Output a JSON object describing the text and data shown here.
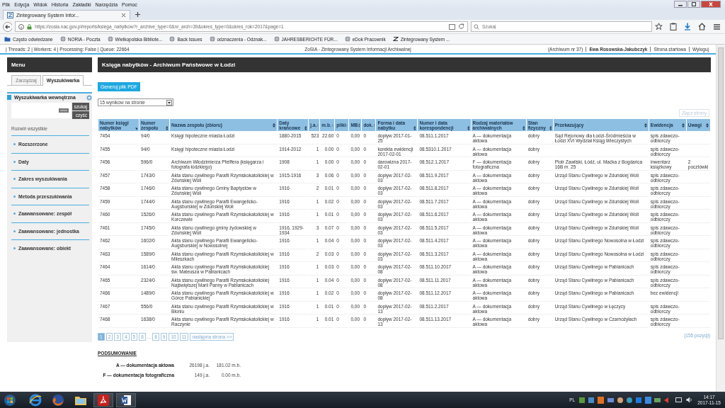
{
  "browser": {
    "menu": [
      "Plik",
      "Edycja",
      "Widok",
      "Historia",
      "Zakładki",
      "Narzędzia",
      "Pomoc"
    ],
    "tab": {
      "title": "Zintegrowany System Infor..."
    },
    "url": "https://zosia.nac.gov.pl/reports/ksiega_nabytkow?r_archive_type=0&nr_arch=39&okres_type=0&okres_rok=2017&page=1",
    "search": {
      "placeholder": "Szukaj"
    },
    "bookmarks": [
      {
        "label": "Często odwiedzane",
        "kind": "folder"
      },
      {
        "label": "NORIA - Poczta",
        "kind": "site"
      },
      {
        "label": "Wielkopolska Bibliote...",
        "kind": "site"
      },
      {
        "label": "Back Issues",
        "kind": "site"
      },
      {
        "label": "odznaczenia - Odznak...",
        "kind": "site"
      },
      {
        "label": "JAHRESBERICHTE FÜR...",
        "kind": "site"
      },
      {
        "label": "eDok Pracownik",
        "kind": "site"
      },
      {
        "label": "Zintegrowany System ...",
        "kind": "app"
      }
    ]
  },
  "status": {
    "info": "| Threads: 2 | Workers: 4 | Processing: False | Queue: 22664",
    "center": "ZoSIA - Zintegrowany System Informacji Archiwalnej",
    "archive": "(Archiwum nr 37)",
    "user": "Ewa Rosowska-Jakubczyk",
    "links": [
      "Strona startowa",
      "Wyloguj"
    ]
  },
  "sidebar": {
    "title": "Menu",
    "tabs": [
      {
        "label": "Zarządzaj",
        "selected": false
      },
      {
        "label": "Wyszukiwarka",
        "selected": true
      }
    ],
    "search": {
      "title": "Wyszukiwarka wewnętrzna",
      "buttons": [
        "szukaj",
        "czyść"
      ]
    },
    "expand_all": "Rozwiń wszystkie",
    "sections": [
      "Rozszerzone",
      "Daty",
      "Zakres wyszukiwania",
      "Metoda przeszukiwania",
      "Zaawansowane: zespół",
      "Zaawansowane: jednostka",
      "Zaawansowane: obiekt"
    ]
  },
  "main": {
    "title": "Księga nabytków - Archiwum Państwowe w Łodzi",
    "pdf_button": "Generuj plik PDF",
    "per_page": "15 wyników na stronie",
    "merge_button": {
      "label": "Złącz strony",
      "disabled": true
    },
    "table": {
      "columns": [
        {
          "label": "Numer księgi nabytków",
          "sorted": true
        },
        {
          "label": "Numer zespołu",
          "sorted": false
        },
        {
          "label": "Nazwa zespołu (zbioru)",
          "sorted": false
        },
        {
          "label": "Daty krańcowe",
          "sorted": false
        },
        {
          "label": "j.a.",
          "sorted": false
        },
        {
          "label": "m.b.",
          "sorted": false
        },
        {
          "label": "pliki",
          "sorted": false
        },
        {
          "label": "MB",
          "sorted": false
        },
        {
          "label": "dok.",
          "sorted": false
        },
        {
          "label": "Forma i data nabytku",
          "sorted": false
        },
        {
          "label": "Numer i data korespondencji",
          "sorted": false
        },
        {
          "label": "Rodzaj materiałów archiwalnych",
          "sorted": false
        },
        {
          "label": "Stan fizyczny",
          "sorted": false
        },
        {
          "label": "Przekazujący",
          "sorted": false
        },
        {
          "label": "Ewidencja",
          "sorted": false
        },
        {
          "label": "Uwagi",
          "sorted": false
        }
      ],
      "rows": [
        [
          "7454",
          "94/0",
          "Księgi hipoteczne miasta Łodzi",
          "1880-2015",
          "523",
          "22.60",
          "0",
          "0,00",
          "0",
          "dopływ 2017-01-25",
          "08.511.1.2017",
          "A — dokumentacja aktowa",
          "dobry",
          "Sąd Rejonowy dla Łodzi-Śródmieścia w Łodzi XVI Wydział Ksiąg Wieczystych",
          "spis zdawczo-odbiorczy",
          null
        ],
        [
          "7455",
          "94/0",
          "Księgi hipoteczne miasta Łodzi",
          "1914-2012",
          "1",
          "0.00",
          "0",
          "0,00",
          "0",
          "korekta ewidencji 2017-02-01",
          "08.5310.1.2017",
          "A — dokumentacja aktowa",
          "dobry",
          null,
          "spis zdawczo-odbiorczy",
          null
        ],
        [
          "7456",
          "596/0",
          "Archiwum Włodzimierza Pfeiffera (księgarza i fotografa łódzkiego)",
          "1908",
          "1",
          "0.00",
          "0",
          "0,00",
          "0",
          "darowizna 2017-02-01",
          "08.512.1.2017",
          "F — dokumentacja fotograficzna",
          "dobry",
          "Piotr Zawilski, Łódź, ul. Maćka z Bogdańca 16B m. 25",
          "inwentarz książkowy",
          "2 pocztówki"
        ],
        [
          "7457",
          "1743/0",
          "Akta stanu cywilnego Parafii Rzymskokatolickiej w Zduńskiej Woli",
          "1915-1916",
          "3",
          "0.06",
          "0",
          "0,00",
          "0",
          "dopływ 2017-02-03",
          "08.511.9.2017",
          "A — dokumentacja aktowa",
          "dobry",
          "Urząd Stanu Cywilnego w Zduńskiej Woli",
          "spis zdawczo-odbiorczy",
          null
        ],
        [
          "7458",
          "1746/0",
          "Akta stanu cywilnego Gminy Baptystów w Zduńskiej Woli",
          "1916",
          "2",
          "0.01",
          "0",
          "0,00",
          "0",
          "dopływ 2017-02-03",
          "08.511.8.2017",
          "A — dokumentacja aktowa",
          "dobry",
          "Urząd Stanu Cywilnego w Zduńskiej Woli",
          "spis zdawczo-odbiorczy",
          null
        ],
        [
          "7459",
          "1744/0",
          "Akta stanu cywilnego Parafii Ewangelicko-Augsburskiej w Zduńskiej Woli",
          "1916",
          "1",
          "0.02",
          "0",
          "0,00",
          "0",
          "dopływ 2017-02-03",
          "08.511.7.2017",
          "A — dokumentacja aktowa",
          "dobry",
          "Urząd Stanu Cywilnego w Zduńskiej Woli",
          "spis zdawczo-odbiorczy",
          null
        ],
        [
          "7460",
          "1526/0",
          "Akta stanu cywilnego Parafii Rzymskokatolickiej w Korczewie",
          "1916",
          "1",
          "0.01",
          "0",
          "0,00",
          "0",
          "dopływ 2017-02-03",
          "08.511.6.2017",
          "A — dokumentacja aktowa",
          "dobry",
          "Urząd Stanu Cywilnego w Zduńskiej Woli",
          "spis zdawczo-odbiorczy",
          null
        ],
        [
          "7461",
          "1745/0",
          "Akta stanu cywilnego gminy żydowskiej w Zduńskiej Woli",
          "1916, 1929-1934",
          "3",
          "0.07",
          "0",
          "0,00",
          "0",
          "dopływ 2017-02-03",
          "08.511.5.2017",
          "A — dokumentacja aktowa",
          "dobry",
          "Urząd Stanu Cywilnego w Zduńskiej Woli",
          "spis zdawczo-odbiorczy",
          null
        ],
        [
          "7462",
          "1602/0",
          "Akta stanu cywilnego Parafii Ewangelicko-Augsburskiej w Nowosolnej",
          "1916",
          "1",
          "0.04",
          "0",
          "0,00",
          "0",
          "dopływ 2017-02-03",
          "08.511.4.2017",
          "A — dokumentacja aktowa",
          "dobry",
          "Urząd Stanu Cywilnego Nowosolna w Łodzi",
          "spis zdawczo-odbiorczy",
          null
        ],
        [
          "7463",
          "1589/0",
          "Akta stanu cywilnego Parafii Rzymskokatolickiej w Mileszkach",
          "1916",
          "2",
          "0.03",
          "0",
          "0,00",
          "0",
          "dopływ 2017-02-03",
          "08.511.3.2017",
          "A — dokumentacja aktowa",
          "dobry",
          "Urząd Stanu Cywilnego Nowosolna w Łodzi",
          "spis zdawczo-odbiorczy",
          null
        ],
        [
          "7464",
          "1614/0",
          "Akta stanu cywilnego Parafii Rzymskokatolickiej św. Mateusza w Pabianicach",
          "1916",
          "1",
          "0.03",
          "0",
          "0,00",
          "0",
          "dopływ 2017-02-08",
          "08.511.10.2017",
          "A — dokumentacja aktowa",
          "dobry",
          "Urząd Stanu Cywilnego w Pabianicach",
          "spis zdawczo-odbiorczy",
          null
        ],
        [
          "7465",
          "2324/0",
          "Akta stanu cywilnego Parafii Rzymskokatolickiej Najświętszej Marii Panny w Pabianicach",
          "1916",
          "1",
          "0.04",
          "0",
          "0,00",
          "0",
          "dopływ 2017-02-08",
          "08.511.11.2017",
          "A — dokumentacja aktowa",
          "dobry",
          "Urząd Stanu Cywilnego w Pabianicach",
          "spis zdawczo-odbiorczy",
          null
        ],
        [
          "7466",
          "1489/0",
          "Akta stanu cywilnego Parafii Rzymskokatolickiej w Górce Pabianickiej",
          "1916",
          "1",
          "0.02",
          "0",
          "0,00",
          "0",
          "dopływ 2017-02-08",
          "08.511.12.2017",
          "A — dokumentacja aktowa",
          "dobry",
          "Urząd Stanu Cywilnego w Pabianicach",
          "bez ewidencji",
          null
        ],
        [
          "7467",
          "556/0",
          "Akta stanu cywilnego Parafii Rzymskokatolickiej w Błoniu",
          "1916",
          "1",
          "0.01",
          "0",
          "0,00",
          "0",
          "dopływ 2017-02-13",
          "08.511.2.2017",
          "A — dokumentacja aktowa",
          "dobry",
          "Urząd Stanu Cywilnego w Łęczycy",
          "spis zdawczo-odbiorczy",
          null
        ],
        [
          "7468",
          "1638/0",
          "Akta stanu cywilnego Parafii Rzymskokatolickiej w Raczynie",
          "1916",
          "1",
          "0.01",
          "0",
          "0,00",
          "0",
          "dopływ 2017-02-13",
          "08.511.13.2017",
          "A — dokumentacja aktowa",
          "dobry",
          "Urząd Stanu Cywilnego w Czarnożyłach",
          "spis zdawczo-odbiorczy",
          null
        ]
      ]
    },
    "pagination": {
      "pages": [
        {
          "label": "1",
          "kind": "page",
          "selected": true
        },
        {
          "label": "2",
          "kind": "page",
          "selected": false
        },
        {
          "label": "3",
          "kind": "page",
          "selected": false
        },
        {
          "label": "4",
          "kind": "page",
          "selected": false
        },
        {
          "label": "5",
          "kind": "page",
          "selected": false
        },
        {
          "label": "6",
          "kind": "page",
          "selected": false
        },
        {
          "label": "...",
          "kind": "gap",
          "selected": false
        },
        {
          "label": "8",
          "kind": "page",
          "selected": false
        },
        {
          "label": "9",
          "kind": "page",
          "selected": false
        },
        {
          "label": "10",
          "kind": "page",
          "selected": false
        },
        {
          "label": "11",
          "kind": "page",
          "selected": false
        }
      ],
      "next": "następna strona >>"
    },
    "count": "(155 pozycji)",
    "summary": {
      "title": "PODSUMOWANIE",
      "rows": [
        [
          "A — dokumentacja aktowa",
          "26198 j.a.",
          "181.02 m.b."
        ],
        [
          "F — dokumentacja fotograficzna",
          "149 j.a.",
          "0.00 m.b."
        ]
      ]
    }
  },
  "taskbar": {
    "language": "PL",
    "time": "14:17",
    "date": "2017-11-15"
  }
}
